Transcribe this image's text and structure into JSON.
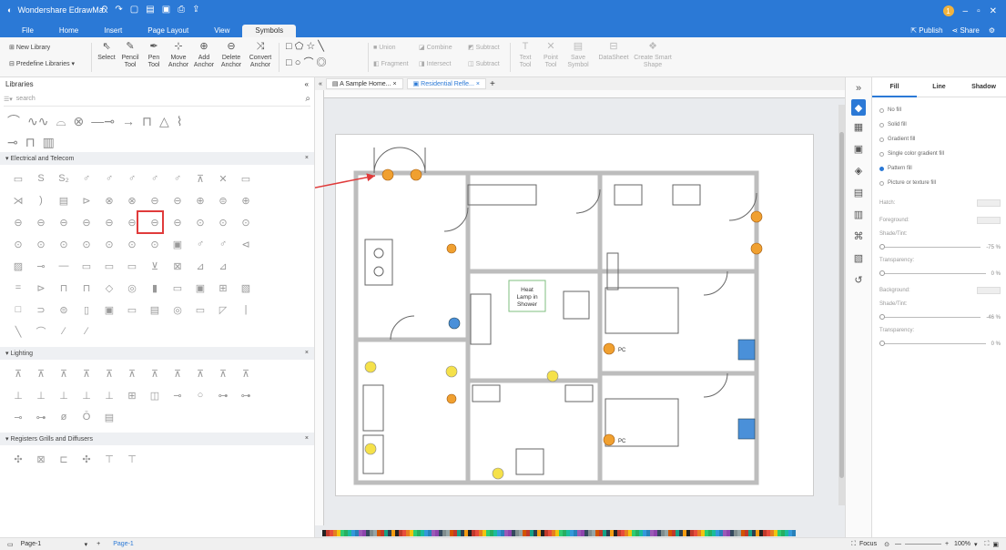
{
  "app": {
    "title": "Wondershare EdrawMax",
    "publish": "Publish",
    "share": "Share",
    "account_badge": "1"
  },
  "menu": {
    "tabs": [
      "File",
      "Home",
      "Insert",
      "Page Layout",
      "View",
      "Symbols"
    ],
    "active_tab": "Symbols"
  },
  "ribbon": {
    "new_library": "New Library",
    "predefine_libraries": "Predefine Libraries",
    "select": "Select",
    "pencil_tool": "Pencil Tool",
    "pen_tool": "Pen Tool",
    "move_anchor": "Move Anchor",
    "add_anchor": "Add Anchor",
    "delete_anchor": "Delete Anchor",
    "convert_anchor": "Convert Anchor",
    "union": "Union",
    "combine": "Combine",
    "subtract": "Subtract",
    "fragment": "Fragment",
    "intersect": "Intersect",
    "subtract2": "Subtract",
    "text_tool": "Text Tool",
    "point_tool": "Point Tool",
    "save_symbol": "Save Symbol",
    "datasheet": "DataSheet",
    "create_smart_shape": "Create Smart Shape"
  },
  "libraries": {
    "title": "Libraries",
    "search_placeholder": "search",
    "sections": [
      {
        "name": "Electrical and Telecom"
      },
      {
        "name": "Lighting"
      },
      {
        "name": "Registers Grills and Diffusers"
      }
    ]
  },
  "documents": {
    "tabs": [
      "A Sample Home...",
      "Residential Refle..."
    ],
    "active": 1
  },
  "floorplan": {
    "label": "Heat Lamp in Shower",
    "pc_labels": [
      "PC",
      "PC"
    ]
  },
  "properties": {
    "tabs": [
      "Fill",
      "Line",
      "Shadow"
    ],
    "active_tab": "Fill",
    "fill_options": [
      "No fill",
      "Solid fill",
      "Gradient fill",
      "Single color gradient fill",
      "Pattern fill",
      "Picture or texture fill"
    ],
    "hatch": "Hatch:",
    "foreground": "Foreground:",
    "shade_tint_1": "Shade/Tint:",
    "shade_value_1": "-75 %",
    "transparency_1": "Transparency:",
    "transparency_value_1": "0 %",
    "background": "Background:",
    "shade_tint_2": "Shade/Tint:",
    "shade_value_2": "-46 %",
    "transparency_2": "Transparency:",
    "transparency_value_2": "0 %"
  },
  "status": {
    "page_name": "Page-1",
    "page_tab": "Page-1",
    "focus": "Focus",
    "zoom": "100%"
  },
  "colors": {
    "accent": "#2b79d6",
    "highlight": "#e03b3b",
    "wall": "#bdbdbd",
    "light_fixture": "#f0a030"
  }
}
